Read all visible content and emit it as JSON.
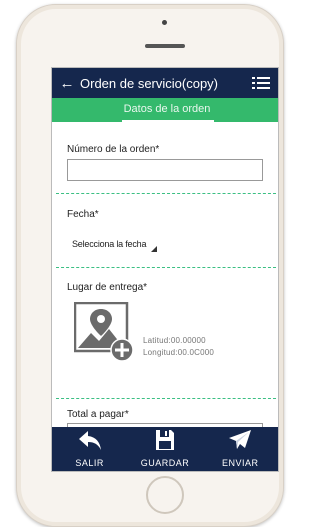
{
  "header": {
    "title": "Orden de servicio(copy)",
    "back_icon": "back-arrow-icon",
    "menu_icon": "list-menu-icon"
  },
  "tabs": [
    {
      "label": "Datos de la orden",
      "active": true
    }
  ],
  "form": {
    "order_number": {
      "label": "Número de la orden*",
      "value": ""
    },
    "date": {
      "label": "Fecha*",
      "placeholder": "Selecciona la fecha"
    },
    "delivery_place": {
      "label": "Lugar de entrega*",
      "latitude": "Latitud:00.00000",
      "longitude": "Longitud:00.0C000"
    },
    "total": {
      "label": "Total a pagar*",
      "value": ""
    }
  },
  "bottom_nav": [
    {
      "label": "SALIR",
      "icon": "exit-arrow-icon"
    },
    {
      "label": "GUARDAR",
      "icon": "save-floppy-icon"
    },
    {
      "label": "ENVIAR",
      "icon": "send-paper-plane-icon"
    }
  ],
  "colors": {
    "appbar": "#15274d",
    "tabbar": "#34b96c",
    "divider": "#3bbf83"
  }
}
